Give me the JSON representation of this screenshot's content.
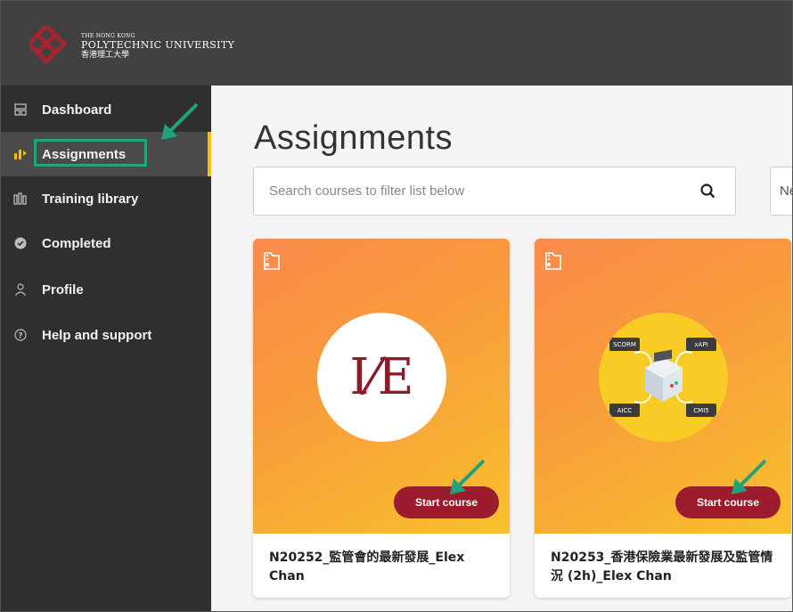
{
  "brand": {
    "line1": "The Hong Kong",
    "line2": "Polytechnic University",
    "line3": "香港理工大學",
    "color": "#a3262e"
  },
  "sidebar": {
    "items": [
      {
        "label": "Dashboard",
        "icon": "dashboard-icon"
      },
      {
        "label": "Assignments",
        "icon": "assignments-icon",
        "active": true
      },
      {
        "label": "Training library",
        "icon": "library-icon"
      },
      {
        "label": "Completed",
        "icon": "check-circle-icon"
      },
      {
        "label": "Profile",
        "icon": "user-icon"
      },
      {
        "label": "Help and support",
        "icon": "help-icon"
      }
    ],
    "active_accent": "#f2c10d"
  },
  "main": {
    "title": "Assignments",
    "search": {
      "placeholder": "Search courses to filter list below",
      "icon": "search-icon"
    },
    "sort_value": "Ne"
  },
  "cards": [
    {
      "logo_text": "I⁄E",
      "button_label": "Start course",
      "title": "N20252_監管會的最新發展_Elex Chan"
    },
    {
      "logo_labels": [
        "SCORM",
        "xAPI",
        "AICC",
        "CMI5"
      ],
      "button_label": "Start course",
      "title": "N20253_香港保險業最新發展及監管情況 (2h)_Elex Chan"
    }
  ],
  "colors": {
    "topbar": "#414141",
    "sidebar": "#2f2f2f",
    "button": "#9c1c2d",
    "annotation": "#1fa37c"
  }
}
